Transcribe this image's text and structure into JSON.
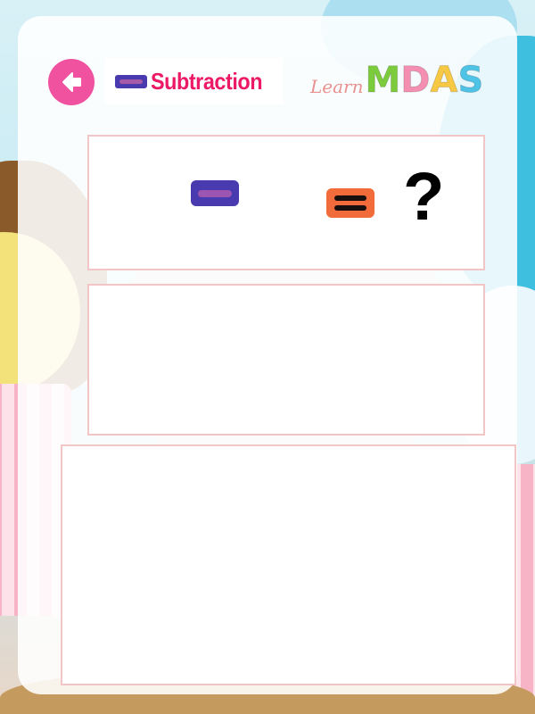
{
  "header": {
    "title": "Subtraction",
    "back_icon": "arrow-left-icon",
    "title_icon": "minus-sign-icon"
  },
  "logo": {
    "prefix": "Learn",
    "letters": [
      {
        "char": "M",
        "color": "#7ccb3c"
      },
      {
        "char": "D",
        "color": "#f48fb1"
      },
      {
        "char": "A",
        "color": "#f7c844"
      },
      {
        "char": "S",
        "color": "#4fc3e6"
      }
    ]
  },
  "problem": {
    "operator_icon": "minus-sign-icon",
    "equals_icon": "equals-sign-icon",
    "unknown": "?"
  },
  "colors": {
    "accent_pink": "#f0529f",
    "title_red": "#ec1a66",
    "minus_purple": "#4a3ab0",
    "equals_orange": "#f26b3a",
    "box_border": "#f2c6c6"
  }
}
